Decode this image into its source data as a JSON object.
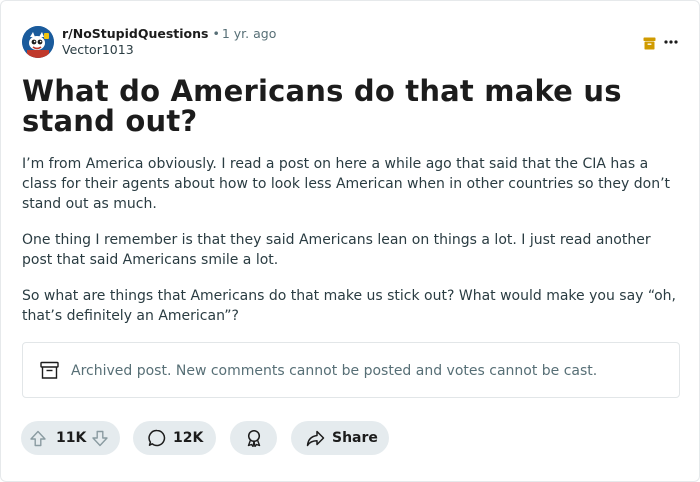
{
  "post": {
    "subreddit": "r/NoStupidQuestions",
    "separator": "•",
    "time_ago": "1 yr. ago",
    "author": "Vector1013",
    "title": "What do Americans do that make us stand out?",
    "paragraphs": [
      "I’m from America obviously. I read a post on here a while ago that said that the CIA has a class for their agents about how to look less American when in other countries so they don’t stand out as much.",
      "One thing I remember is that they said Americans lean on things a lot. I just read another post that said Americans smile a lot.",
      "So what are things that Americans do that make us stick out? What would make you say “oh, that’s definitely an American”?"
    ],
    "archived_notice": "Archived post. New comments cannot be posted and votes cannot be cast."
  },
  "actions": {
    "vote_count": "11K",
    "comment_count": "12K",
    "share_label": "Share"
  },
  "icons": {
    "archive_badge": "archive-box-icon",
    "more": "more-dots-icon",
    "upvote": "upvote-arrow-icon",
    "downvote": "downvote-arrow-icon",
    "comment": "comment-bubble-icon",
    "award": "award-ribbon-icon",
    "share": "share-arrow-icon"
  },
  "colors": {
    "archive_badge": "#d09b00",
    "pill_background": "#e5ebee",
    "muted_text": "#576f76",
    "avatar_background": "#1a5b9c"
  }
}
